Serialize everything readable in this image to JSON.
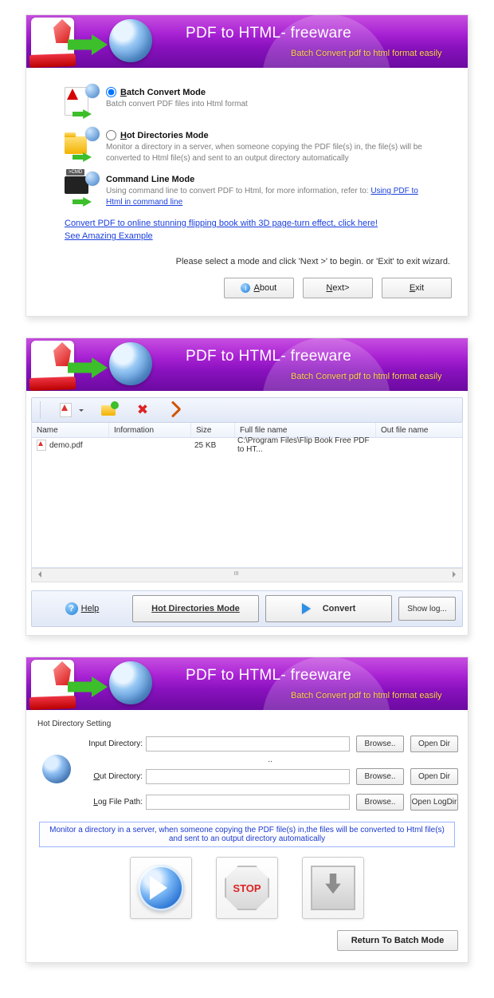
{
  "header": {
    "title": "PDF to HTML- freeware",
    "subtitle": "Batch Convert  pdf to html format easily"
  },
  "panel1": {
    "modes": [
      {
        "label_pre": "B",
        "label_rest": "atch Convert Mode",
        "desc": "Batch convert PDF files into Html format",
        "checked": true,
        "icon": "pdf-html"
      },
      {
        "label_pre": "H",
        "label_rest": "ot Directories Mode",
        "desc": "Monitor a directory in a server, when someone copying the PDF file(s) in, the file(s) will be converted to Html file(s) and sent to an output directory automatically",
        "checked": false,
        "icon": "folder-html"
      },
      {
        "label_pre": "",
        "label_rest": "Command Line Mode",
        "desc_pre": "Using command line to convert PDF to Html, for more information, refer to:  ",
        "desc_link": "Using PDF to Html in command line",
        "icon": "cmd-html",
        "no_radio": true
      }
    ],
    "links": {
      "l1": "Convert PDF to online stunning flipping book with 3D page-turn effect, click here!",
      "l2": "See Amazing Example "
    },
    "instruction": "Please select a mode and click 'Next >' to begin. or 'Exit' to exit wizard.",
    "buttons": {
      "about_u": "A",
      "about_rest": "bout",
      "next_u": "N",
      "next_rest": "ext>",
      "exit_u": "E",
      "exit_rest": "xit"
    }
  },
  "panel2": {
    "columns": {
      "name": "Name",
      "info": "Information",
      "size": "Size",
      "full": "Full file name",
      "out": "Out file name"
    },
    "rows": [
      {
        "name": "demo.pdf",
        "info": "",
        "size": "25 KB",
        "full": "C:\\Program Files\\Flip Book Free PDF to HT...",
        "out": ""
      }
    ],
    "scroll_marker": "III",
    "help_u": "H",
    "help_rest": "elp",
    "hotdir_btn": "Hot Directories Mode",
    "convert_btn": "Convert",
    "showlog_btn": "Show log..."
  },
  "panel3": {
    "fieldset_title": "Hot Directory Setting",
    "labels": {
      "input": "Input Directory:",
      "out_u": "O",
      "out_rest": "ut Directory:",
      "log_u": "L",
      "log_rest": "og File Path:"
    },
    "dots": "..",
    "browse": "Browse..",
    "opendir": "Open Dir",
    "openlog": "Open LogDir",
    "note": "Monitor a directory in a server, when someone copying the PDF file(s) in,the files will be converted to Html file(s) and sent to an output directory automatically",
    "stop_label": "STOP",
    "return_btn": "Return To Batch Mode"
  }
}
